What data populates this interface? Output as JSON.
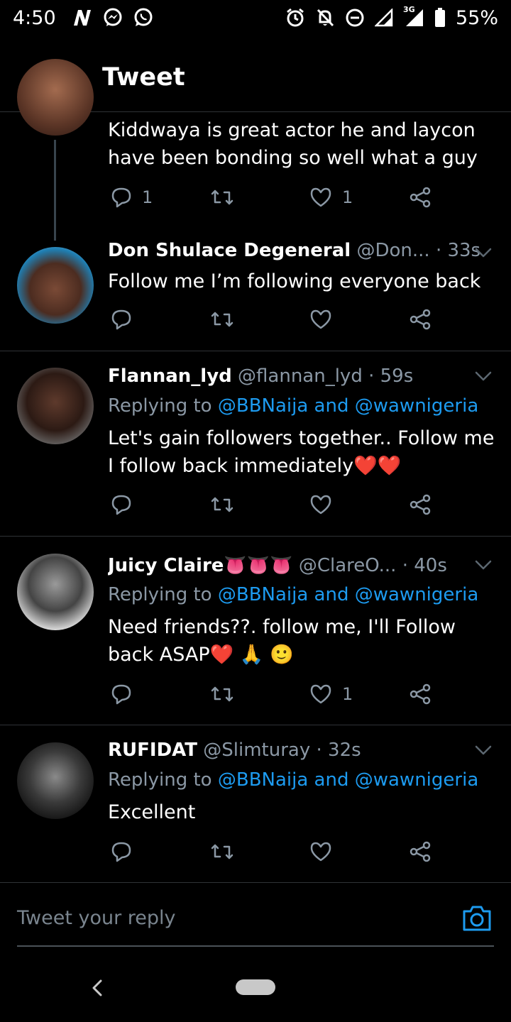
{
  "status_bar": {
    "time": "4:50",
    "app_icons": [
      "n-icon",
      "messenger-icon",
      "whatsapp-icon"
    ],
    "system_icons": [
      "alarm-icon",
      "notifications-off-icon",
      "do-not-disturb-icon",
      "signal-icon",
      "3g-signal-icon",
      "battery-icon"
    ],
    "network": "3G",
    "battery": "55%"
  },
  "header": {
    "title": "Tweet"
  },
  "colors": {
    "background": "#000000",
    "link": "#1d9bf0",
    "secondary_text": "#8b98a5",
    "divider": "#2f3336"
  },
  "tweets": [
    {
      "body": "Kiddwaya is great actor he and laycon have been bonding so well what a guy",
      "reply_count": "1",
      "like_count": "1"
    },
    {
      "name": "Don Shulace Degeneral",
      "handle": "@Don...",
      "time": "· 33s",
      "body": "Follow me I’m following everyone back",
      "reply_count": "",
      "like_count": ""
    },
    {
      "name": "Flannan_lyd",
      "handle": "@flannan_lyd",
      "time": "· 59s",
      "replying_prefix": "Replying to",
      "replying_to": "@BBNaija and @wawnigeria",
      "body": "Let's gain followers together..  Follow me I follow back immediately❤️❤️",
      "reply_count": "",
      "like_count": ""
    },
    {
      "name": "Juicy Claire👅👅👅",
      "handle": "@ClareO...",
      "time": "· 40s",
      "replying_prefix": "Replying to",
      "replying_to": "@BBNaija and @wawnigeria",
      "body": "Need friends??. follow me, I'll Follow back ASAP❤️ 🙏 🙂",
      "reply_count": "",
      "like_count": "1"
    },
    {
      "name": "RUFIDAT",
      "handle": "@Slimturay",
      "time": "· 32s",
      "replying_prefix": "Replying to",
      "replying_to": "@BBNaija and @wawnigeria",
      "body": "Excellent",
      "reply_count": "",
      "like_count": ""
    }
  ],
  "composer": {
    "placeholder": "Tweet your reply"
  }
}
